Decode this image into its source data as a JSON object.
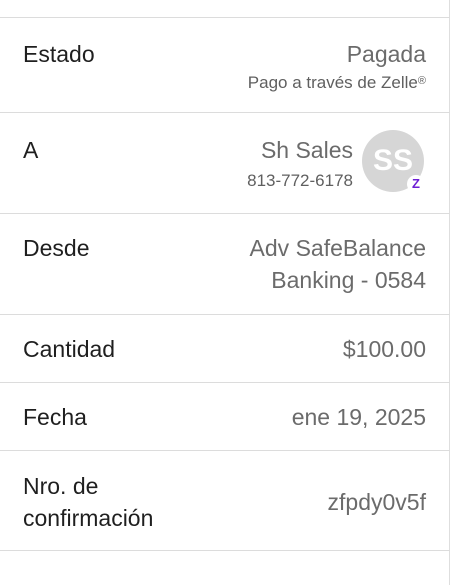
{
  "rows": {
    "status": {
      "label": "Estado",
      "value": "Pagada",
      "subtitle": "Pago a través de Zelle",
      "subtitle_mark": "®"
    },
    "to": {
      "label": "A",
      "name": "Sh Sales",
      "phone": "813-772-6178",
      "avatar_initials": "SS",
      "badge_icon": "zelle-z-icon",
      "badge_glyph": "Z"
    },
    "from": {
      "label": "Desde",
      "account_line1": "Adv SafeBalance",
      "account_line2": "Banking - 0584"
    },
    "amount": {
      "label": "Cantidad",
      "value": "$100.00"
    },
    "date": {
      "label": "Fecha",
      "value": "ene 19, 2025"
    },
    "confirmation": {
      "label_line1": "Nro. de",
      "label_line2": "confirmación",
      "value": "zfpdy0v5f"
    }
  },
  "colors": {
    "label_text": "#1f1f1f",
    "value_text": "#6b6b6b",
    "divider": "#dcdcdc",
    "avatar_bg": "#d6d6d6",
    "zelle_purple": "#6d1ed4"
  }
}
